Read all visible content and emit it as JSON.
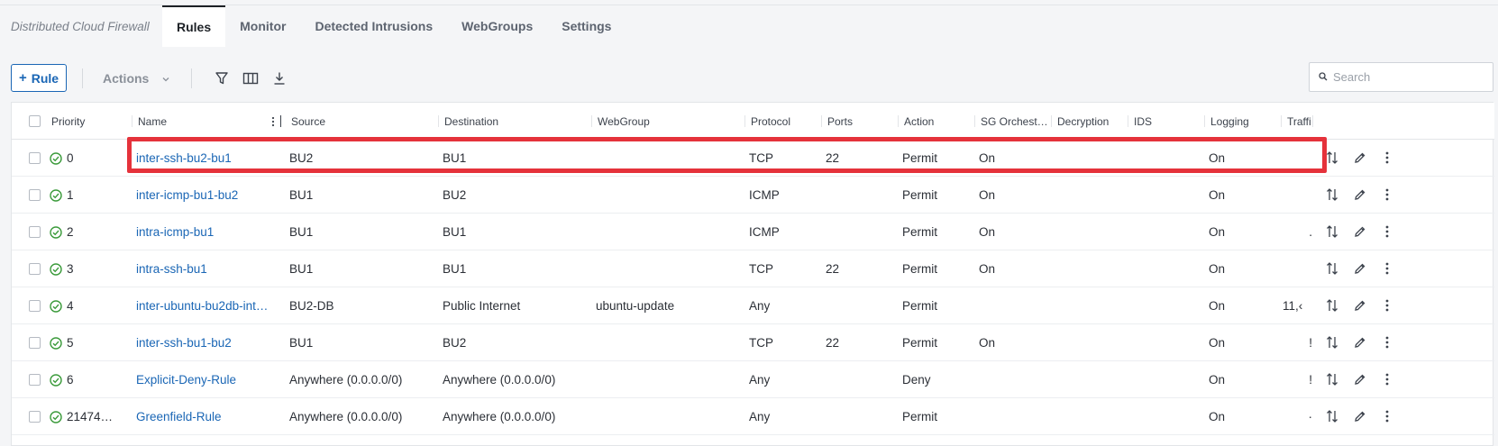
{
  "app": {
    "title": "Distributed Cloud Firewall"
  },
  "tabs": [
    {
      "label": "Rules",
      "active": true
    },
    {
      "label": "Monitor",
      "active": false
    },
    {
      "label": "Detected Intrusions",
      "active": false
    },
    {
      "label": "WebGroups",
      "active": false
    },
    {
      "label": "Settings",
      "active": false
    }
  ],
  "toolbar": {
    "add_rule_label": "Rule",
    "actions_label": "Actions",
    "icons": [
      "filter-icon",
      "columns-icon",
      "download-icon"
    ],
    "search_placeholder": "Search"
  },
  "table": {
    "columns": [
      "Priority",
      "Name",
      "Source",
      "Destination",
      "WebGroup",
      "Protocol",
      "Ports",
      "Action",
      "SG Orchest…",
      "Decryption",
      "IDS",
      "Logging",
      "Traffi"
    ],
    "rows": [
      {
        "priority": "0",
        "name": "inter-ssh-bu2-bu1",
        "source": "BU2",
        "destination": "BU1",
        "webgroup": "",
        "protocol": "TCP",
        "ports": "22",
        "action": "Permit",
        "sg": "On",
        "decryption": "",
        "ids": "",
        "logging": "On",
        "traffic": "",
        "highlighted": true
      },
      {
        "priority": "1",
        "name": "inter-icmp-bu1-bu2",
        "source": "BU1",
        "destination": "BU2",
        "webgroup": "",
        "protocol": "ICMP",
        "ports": "",
        "action": "Permit",
        "sg": "On",
        "decryption": "",
        "ids": "",
        "logging": "On",
        "traffic": ""
      },
      {
        "priority": "2",
        "name": "intra-icmp-bu1",
        "source": "BU1",
        "destination": "BU1",
        "webgroup": "",
        "protocol": "ICMP",
        "ports": "",
        "action": "Permit",
        "sg": "On",
        "decryption": "",
        "ids": "",
        "logging": "On",
        "traffic": "."
      },
      {
        "priority": "3",
        "name": "intra-ssh-bu1",
        "source": "BU1",
        "destination": "BU1",
        "webgroup": "",
        "protocol": "TCP",
        "ports": "22",
        "action": "Permit",
        "sg": "On",
        "decryption": "",
        "ids": "",
        "logging": "On",
        "traffic": ""
      },
      {
        "priority": "4",
        "name": "inter-ubuntu-bu2db-int…",
        "source": "BU2-DB",
        "destination": "Public Internet",
        "webgroup": "ubuntu-update",
        "protocol": "Any",
        "ports": "",
        "action": "Permit",
        "sg": "",
        "decryption": "",
        "ids": "",
        "logging": "On",
        "traffic": "11,‹"
      },
      {
        "priority": "5",
        "name": "inter-ssh-bu1-bu2",
        "source": "BU1",
        "destination": "BU2",
        "webgroup": "",
        "protocol": "TCP",
        "ports": "22",
        "action": "Permit",
        "sg": "On",
        "decryption": "",
        "ids": "",
        "logging": "On",
        "traffic": "!"
      },
      {
        "priority": "6",
        "name": "Explicit-Deny-Rule",
        "source": "Anywhere (0.0.0.0/0)",
        "destination": "Anywhere (0.0.0.0/0)",
        "webgroup": "",
        "protocol": "Any",
        "ports": "",
        "action": "Deny",
        "sg": "",
        "decryption": "",
        "ids": "",
        "logging": "On",
        "traffic": "!"
      },
      {
        "priority": "21474…",
        "name": "Greenfield-Rule",
        "source": "Anywhere (0.0.0.0/0)",
        "destination": "Anywhere (0.0.0.0/0)",
        "webgroup": "",
        "protocol": "Any",
        "ports": "",
        "action": "Permit",
        "sg": "",
        "decryption": "",
        "ids": "",
        "logging": "On",
        "traffic": "·"
      }
    ]
  },
  "colors": {
    "link": "#1a66b5",
    "status_ok": "#3a9a3a",
    "highlight": "#e5323b"
  }
}
